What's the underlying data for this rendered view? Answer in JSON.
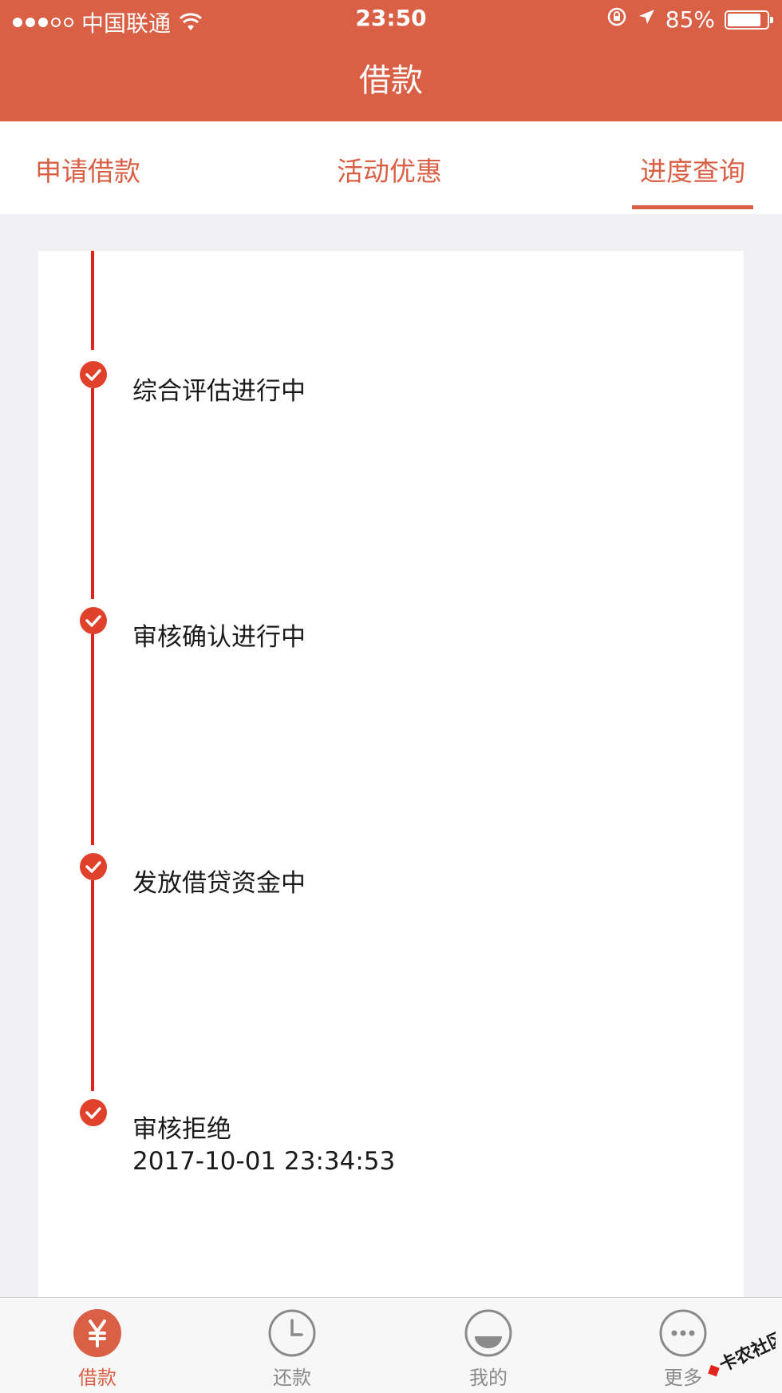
{
  "status_bar": {
    "carrier": "中国联通",
    "time": "23:50",
    "battery": "85%",
    "battery_level": 0.85,
    "signal_dots_filled": 3,
    "signal_dots_total": 5
  },
  "nav": {
    "title": "借款"
  },
  "tabs": [
    {
      "label": "申请借款"
    },
    {
      "label": "活动优惠"
    },
    {
      "label": "进度查询",
      "active": true
    }
  ],
  "timeline": [
    {
      "label": "综合评估进行中"
    },
    {
      "label": "审核确认进行中"
    },
    {
      "label": "发放借贷资金中"
    },
    {
      "label": "审核拒绝",
      "timestamp": "2017-10-01 23:34:53"
    }
  ],
  "tabbar": [
    {
      "label": "借款",
      "icon": "yen-icon",
      "active": true
    },
    {
      "label": "还款",
      "icon": "clock-icon"
    },
    {
      "label": "我的",
      "icon": "profile-icon"
    },
    {
      "label": "更多",
      "icon": "more-icon"
    }
  ],
  "watermark": {
    "text": "卡农社区"
  },
  "colors": {
    "accent": "#d95f45",
    "timeline_red": "#e0241b"
  }
}
